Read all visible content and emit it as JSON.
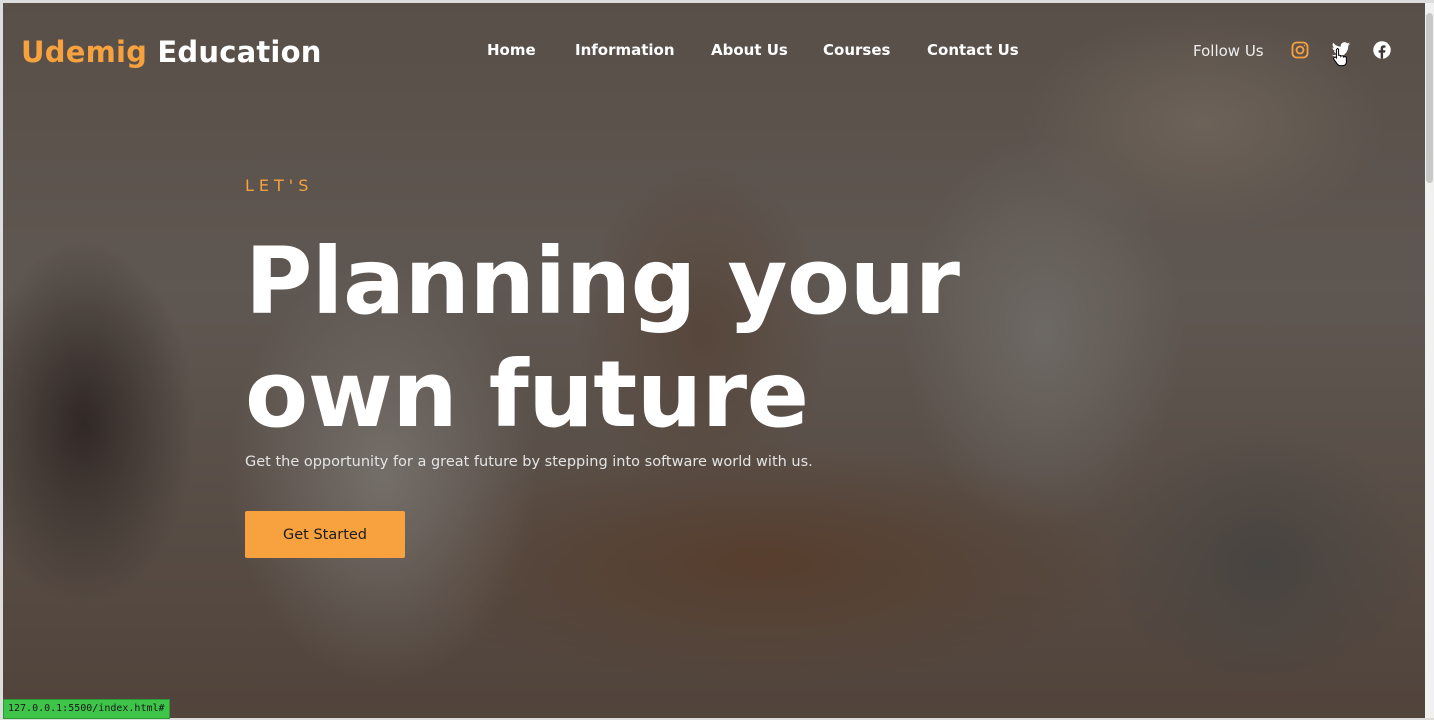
{
  "brand": {
    "part1": "Udemig",
    "part2": "Education",
    "accent": "#f7a23e"
  },
  "nav": {
    "items": [
      {
        "label": "Home"
      },
      {
        "label": "Information"
      },
      {
        "label": "About Us"
      },
      {
        "label": "Courses"
      },
      {
        "label": "Contact Us"
      }
    ]
  },
  "social": {
    "label": "Follow Us",
    "icons": [
      "instagram-icon",
      "twitter-icon",
      "facebook-icon"
    ]
  },
  "hero": {
    "eyebrow": "LET'S",
    "title_line1": "Planning your",
    "title_line2": "own future",
    "subtitle": "Get the opportunity for a great future by stepping into software world with us.",
    "cta_label": "Get Started"
  },
  "status_bar": {
    "url": "127.0.0.1:5500/index.html#"
  }
}
